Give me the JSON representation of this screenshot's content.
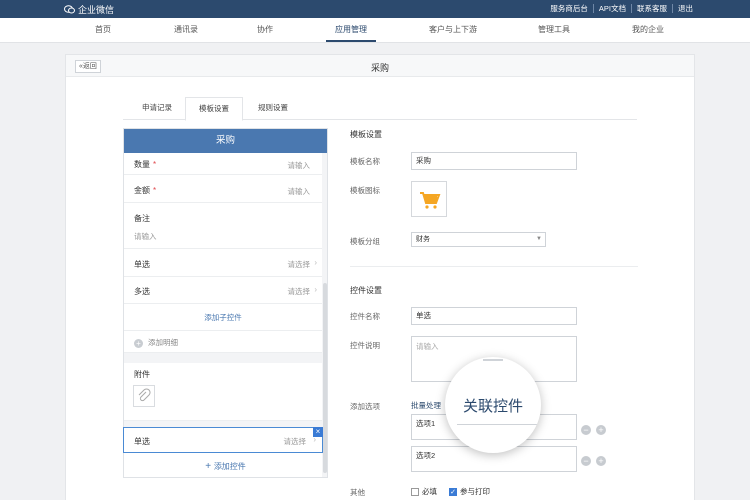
{
  "app": {
    "logo_text": "企业微信"
  },
  "toplinks": [
    "服务商后台",
    "API文档",
    "联系客服",
    "退出"
  ],
  "nav": [
    "首页",
    "通讯录",
    "协作",
    "应用管理",
    "客户与上下游",
    "管理工具",
    "我的企业"
  ],
  "nav_active": "应用管理",
  "panel": {
    "back_label": "返回",
    "title": "采购"
  },
  "tabs": [
    "申请记录",
    "模板设置",
    "规则设置"
  ],
  "tab_active": "模板设置",
  "preview": {
    "header": "采购",
    "rows": {
      "qty": {
        "label": "数量",
        "required": "*",
        "value": "请输入"
      },
      "amount": {
        "label": "金额",
        "required": "*",
        "value": "请输入"
      },
      "note": {
        "label": "备注",
        "value": "请输入"
      },
      "single": {
        "label": "单选",
        "value": "请选择"
      },
      "multi": {
        "label": "多选",
        "value": "请选择"
      }
    },
    "add_sub_control": "添加子控件",
    "add_detail": "添加明细",
    "attachment": "附件",
    "selected_row": {
      "label": "单选",
      "value": "请选择"
    },
    "add_control": "添加控件"
  },
  "template_settings": {
    "section_title": "模板设置",
    "name_label": "模板名称",
    "name_value": "采购",
    "icon_label": "模板图标",
    "group_label": "模板分组",
    "group_value": "财务"
  },
  "control_settings": {
    "section_title": "控件设置",
    "name_label": "控件名称",
    "name_value": "单选",
    "desc_label": "控件说明",
    "desc_placeholder": "请输入",
    "options_label": "添加选项",
    "batch_label": "批量处理",
    "options": [
      "选项1",
      "选项2"
    ],
    "other_label": "其他",
    "required_label": "必填",
    "print_label": "参与打印"
  },
  "magnifier": {
    "text": "关联控件"
  },
  "colors": {
    "topbar": "#2c4a6e",
    "preview_header": "#4a78b0",
    "cart": "#f5a623",
    "accent": "#3a7bd5"
  }
}
